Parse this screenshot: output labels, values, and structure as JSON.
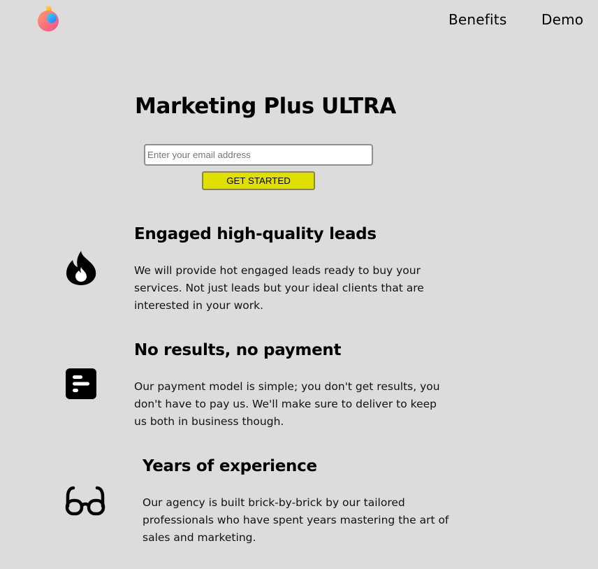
{
  "header": {
    "logo_icon": "brand-logo-icon",
    "nav": [
      {
        "label": "Benefits"
      },
      {
        "label": "Demo"
      }
    ]
  },
  "hero": {
    "title": "Marketing Plus ULTRA",
    "email_placeholder": "Enter your email address",
    "cta_label": "GET STARTED"
  },
  "features": [
    {
      "icon": "fire-icon",
      "title": "Engaged high-quality leads",
      "text": "We will provide hot engaged leads ready to buy your services. Not just leads but your ideal clients that are interested in your work."
    },
    {
      "icon": "chart-bar-icon",
      "title": "No results, no payment",
      "text": "Our payment model is simple; you don't get results, you don't have to pay us. We'll make sure to deliver to keep us both in business though."
    },
    {
      "icon": "glasses-icon",
      "title": "Years of experience",
      "text": "Our agency is built brick-by-brick by our tailored professionals who have spent years mastering the art of sales and marketing."
    }
  ],
  "colors": {
    "background": "#dcdcdc",
    "cta_background": "#dfe000",
    "text": "#000000"
  }
}
